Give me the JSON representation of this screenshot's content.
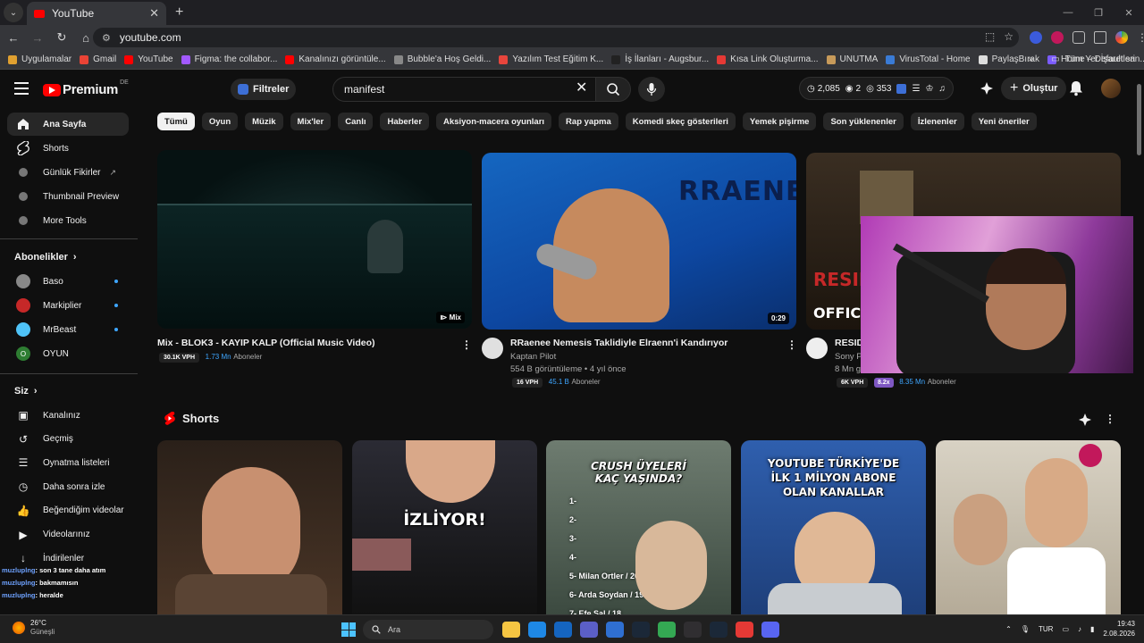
{
  "browser": {
    "tab_title": "YouTube",
    "url": "youtube.com",
    "bookmarks": [
      {
        "label": "Uygulamalar",
        "color": "#e0a030"
      },
      {
        "label": "Gmail",
        "color": "#ea4335"
      },
      {
        "label": "YouTube",
        "color": "#ff0000"
      },
      {
        "label": "Figma: the collabor...",
        "color": "#a259ff"
      },
      {
        "label": "Kanalınızı görüntüle...",
        "color": "#ff0000"
      },
      {
        "label": "Bubble'a Hoş Geldi...",
        "color": "#888888"
      },
      {
        "label": "Yazılım Test Eğitim K...",
        "color": "#e8453c"
      },
      {
        "label": "İş İlanları - Augsbur...",
        "color": "#222222"
      },
      {
        "label": "Kısa Link Oluşturma...",
        "color": "#e53935"
      },
      {
        "label": "UNUTMA",
        "color": "#c79a5a"
      },
      {
        "label": "VirusTotal - Home",
        "color": "#3a7bd5"
      },
      {
        "label": "PaylaşBırak",
        "color": "#dddddd"
      },
      {
        "label": "Home – Default san...",
        "color": "#7b5cff"
      }
    ],
    "all_bookmarks": "Tüm Yer İşaretleri"
  },
  "masthead": {
    "logo_text": "Premium",
    "country": "DE",
    "filters_label": "Filtreler",
    "search_value": "manifest",
    "stats": {
      "views": "2,085",
      "eye": "2",
      "watch": "353"
    },
    "create_label": "Oluştur"
  },
  "sidebar": {
    "main": [
      {
        "label": "Ana Sayfa",
        "icon": "home-icon"
      },
      {
        "label": "Shorts",
        "icon": "shorts-icon"
      },
      {
        "label": "Günlük Fikirler",
        "icon": "ideas-icon"
      },
      {
        "label": "Thumbnail Preview",
        "icon": "preview-icon"
      },
      {
        "label": "More Tools",
        "icon": "tools-icon"
      }
    ],
    "subscriptions_title": "Abonelikler",
    "subscriptions": [
      {
        "label": "Baso",
        "color": "#888888"
      },
      {
        "label": "Markiplier",
        "color": "#c62828"
      },
      {
        "label": "MrBeast",
        "color": "#4fc3f7"
      },
      {
        "label": "OYUN",
        "color": "#2e7d32",
        "letter": "O"
      }
    ],
    "you_title": "Siz",
    "you": [
      {
        "label": "Kanalınız"
      },
      {
        "label": "Geçmiş"
      },
      {
        "label": "Oynatma listeleri"
      },
      {
        "label": "Daha sonra izle"
      },
      {
        "label": "Beğendiğim videolar"
      },
      {
        "label": "Videolarınız"
      },
      {
        "label": "İndirilenler"
      }
    ]
  },
  "chips": [
    "Tümü",
    "Oyun",
    "Müzik",
    "Mix'ler",
    "Canlı",
    "Haberler",
    "Aksiyon-macera oyunları",
    "Rap yapma",
    "Komedi skeç gösterileri",
    "Yemek pişirme",
    "Son yüklenenler",
    "İzlenenler",
    "Yeni öneriler"
  ],
  "videos": [
    {
      "title": "Mix - BLOK3 - KAYIP KALP (Official Music Video)",
      "vph": "30.1K VPH",
      "subs": "1.73 Mn",
      "subs_label": "Aboneler",
      "badge": "Mix"
    },
    {
      "title": "RRaenee Nemesis Taklidiyle Elraenn'i Kandırıyor",
      "channel": "Kaptan Pilot",
      "meta": "554 B görüntüleme • 4 yıl önce",
      "vph": "16 VPH",
      "subs": "45.1 B",
      "subs_label": "Aboneler",
      "badge": "0:29",
      "thumb_text": "RRAENE"
    },
    {
      "title": "RESID",
      "channel": "Sony P",
      "meta": "8 Mn g",
      "vph": "6K VPH",
      "ratio": "8.2x",
      "subs": "8.35 Mn",
      "subs_label": "Aboneler",
      "thumb_text": "RESID",
      "thumb_text2": "OFFICIA"
    }
  ],
  "shorts": {
    "title": "Shorts",
    "items": [
      {
        "text": ""
      },
      {
        "text": "İZLİYOR!"
      },
      {
        "text": "CRUSH ÜYELERİ KAÇ YAŞINDA?",
        "list": [
          "1-",
          "2-",
          "3-",
          "4-",
          "5- Milan Ortler / 20",
          "6- Arda Soydan / 19",
          "7- Efe Şal / 18"
        ]
      },
      {
        "text": "YOUTUBE TÜRKİYE'DE İLK 1 MİLYON ABONE OLAN KANALLAR"
      },
      {
        "text": ""
      }
    ]
  },
  "chat": [
    {
      "user": "muzluplng",
      "msg": "son 3 tane daha atım"
    },
    {
      "user": "muzluplng",
      "msg": "bakmamısın"
    },
    {
      "user": "muzluplng",
      "msg": "heralde"
    }
  ],
  "taskbar": {
    "temp": "26°C",
    "weather": "Güneşli",
    "search": "Ara",
    "lang": "TUR",
    "time": "19:43",
    "date": "2.08.2026"
  }
}
